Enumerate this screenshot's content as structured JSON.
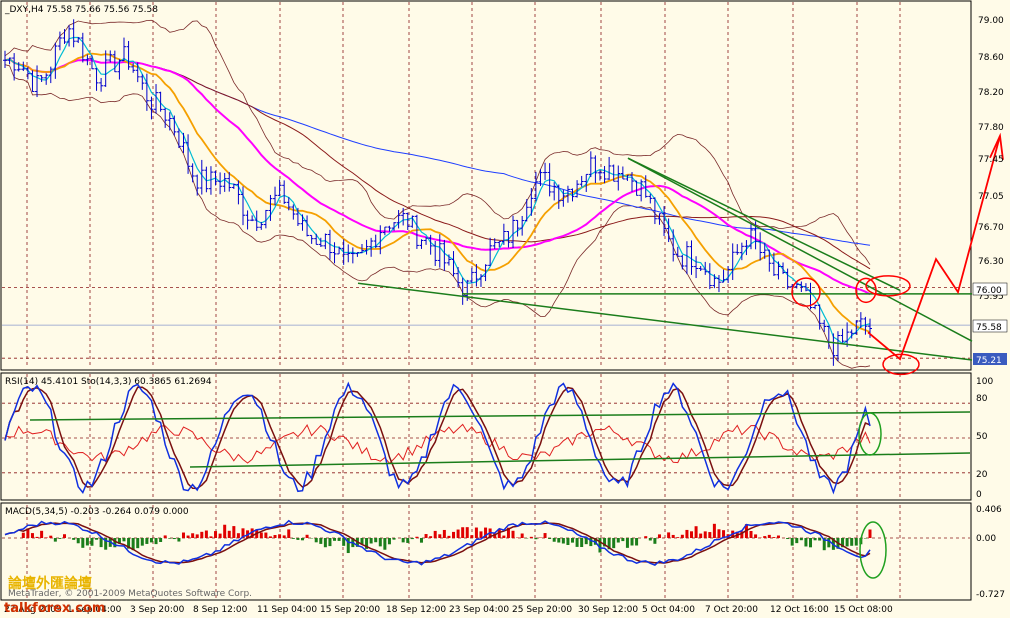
{
  "colors": {
    "background": "#fffbe8",
    "grid": "#8b1a1a",
    "price_bar": "#0000cc",
    "ma_fast": "#00bcd4",
    "ma_orange": "#f5a000",
    "ma_magenta": "#ff00ff",
    "ma_dark": "#8b1a1a",
    "ma_blue": "#1f3fff",
    "trend": "#1b7d1b",
    "annot": "#ff0000",
    "macd_pos": "#e00000",
    "macd_neg": "#1b7d1b"
  },
  "panels": {
    "price": {
      "header": "_DXY,H4  75.58 75.66 75.56 75.58",
      "yticks": [
        "79.00",
        "78.60",
        "78.20",
        "77.80",
        "77.45",
        "77.05",
        "76.70",
        "76.30",
        "75.95",
        "75.58",
        "75.21"
      ],
      "tags": [
        "76.00",
        "75.58",
        "75.21"
      ]
    },
    "rsi": {
      "header": "RSI(14) 45.4101  Sto(14,3,3) 60.3865 61.2694",
      "yticks": [
        "100",
        "80",
        "50",
        "20",
        "0"
      ]
    },
    "macd": {
      "header": "MACD(5,34,5) -0.203 -0.264 0.079 0.000",
      "yticks": [
        "0.406",
        "0.00",
        "-0.727"
      ]
    }
  },
  "xticks": [
    "27 Aug 2009",
    "1 Sep 04:00",
    "3 Sep 20:00",
    "8 Sep 12:00",
    "11 Sep 04:00",
    "15 Sep 20:00",
    "18 Sep 12:00",
    "23 Sep 04:00",
    "25 Sep 20:00",
    "30 Sep 12:00",
    "5 Oct 04:00",
    "7 Oct 20:00",
    "12 Oct 16:00",
    "15 Oct 08:00"
  ],
  "watermark": {
    "brand": "talkforex.com",
    "chinese": "論壇外匯論壇",
    "copyright": "MetaTrader, © 2001-2009 MetaQuotes Software Corp."
  },
  "chart_data": {
    "type": "candlestick",
    "symbol": "_DXY",
    "timeframe": "H4",
    "last_quote": {
      "open": 75.58,
      "high": 75.66,
      "low": 75.56,
      "close": 75.58
    },
    "price_path": [
      {
        "x": "27 Aug 2009",
        "y": 78.55
      },
      {
        "x": "28 Aug",
        "y": 78.3
      },
      {
        "x": "1 Sep 04:00",
        "y": 78.85
      },
      {
        "x": "2 Sep",
        "y": 78.45
      },
      {
        "x": "3 Sep 20:00",
        "y": 78.5
      },
      {
        "x": "4 Sep",
        "y": 78.05
      },
      {
        "x": "8 Sep 12:00",
        "y": 77.35
      },
      {
        "x": "9 Sep",
        "y": 77.15
      },
      {
        "x": "10 Sep",
        "y": 76.85
      },
      {
        "x": "11 Sep 04:00",
        "y": 76.95
      },
      {
        "x": "14 Sep",
        "y": 76.6
      },
      {
        "x": "15 Sep 20:00",
        "y": 76.25
      },
      {
        "x": "17 Sep",
        "y": 76.55
      },
      {
        "x": "18 Sep 12:00",
        "y": 76.85
      },
      {
        "x": "21 Sep",
        "y": 76.3
      },
      {
        "x": "23 Sep 04:00",
        "y": 76.05
      },
      {
        "x": "24 Sep",
        "y": 76.45
      },
      {
        "x": "25 Sep 20:00",
        "y": 77.1
      },
      {
        "x": "28 Sep",
        "y": 77.15
      },
      {
        "x": "30 Sep 12:00",
        "y": 77.3
      },
      {
        "x": "1 Oct",
        "y": 77.4
      },
      {
        "x": "5 Oct 04:00",
        "y": 76.8
      },
      {
        "x": "6 Oct",
        "y": 76.35
      },
      {
        "x": "7 Oct 20:00",
        "y": 76.1
      },
      {
        "x": "9 Oct",
        "y": 76.5
      },
      {
        "x": "12 Oct 16:00",
        "y": 76.2
      },
      {
        "x": "13 Oct",
        "y": 75.75
      },
      {
        "x": "14 Oct",
        "y": 75.35
      },
      {
        "x": "15 Oct 08:00",
        "y": 75.58
      }
    ],
    "overlays": [
      "Bollinger Bands",
      "moving averages (cyan, orange, magenta, dark red, blue)"
    ],
    "horizontal_levels": [
      76.0,
      75.58,
      75.21
    ],
    "indicators": {
      "rsi14": 45.4101,
      "stochastic": {
        "k": 60.3865,
        "d": 61.2694
      },
      "macd": {
        "main": -0.203,
        "signal": -0.264,
        "osma": 0.079,
        "zero": 0.0
      }
    },
    "ylim_price": [
      75.1,
      79.2
    ],
    "grid": true
  }
}
